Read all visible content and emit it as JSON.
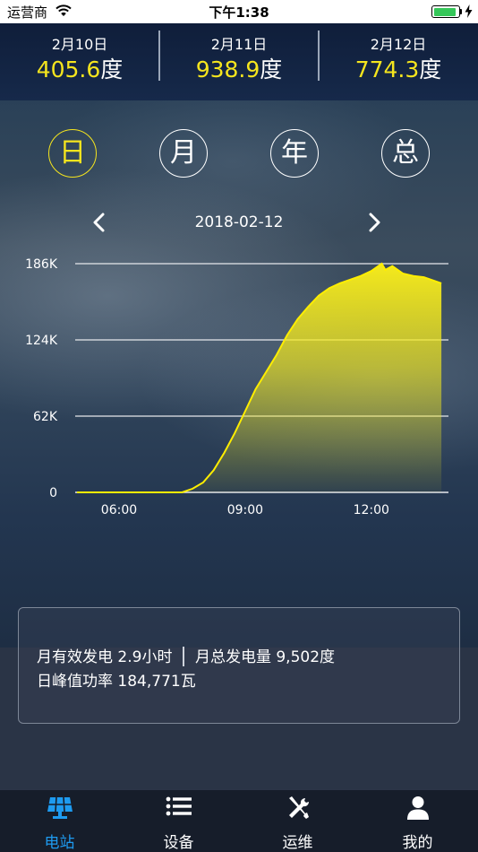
{
  "status_bar": {
    "carrier": "运营商",
    "time": "下午1:38",
    "battery_level": 0.9,
    "icons": [
      "wifi-icon",
      "battery-icon",
      "charging-bolt-icon"
    ]
  },
  "daily_summary": [
    {
      "date": "2月10日",
      "value": "405.6",
      "unit": "度"
    },
    {
      "date": "2月11日",
      "value": "938.9",
      "unit": "度"
    },
    {
      "date": "2月12日",
      "value": "774.3",
      "unit": "度"
    }
  ],
  "period_tabs": [
    {
      "label": "日",
      "active": true
    },
    {
      "label": "月",
      "active": false
    },
    {
      "label": "年",
      "active": false
    },
    {
      "label": "总",
      "active": false
    }
  ],
  "date_nav": {
    "date": "2018-02-12",
    "prev_icon": "chevron-left-icon",
    "next_icon": "chevron-right-icon"
  },
  "chart_data": {
    "type": "area",
    "title": "",
    "xlabel": "",
    "ylabel": "",
    "x_ticks": [
      "06:00",
      "09:00",
      "12:00"
    ],
    "y_ticks": [
      "0",
      "62K",
      "124K",
      "186K"
    ],
    "xlim": [
      "05:00",
      "13:45"
    ],
    "ylim": [
      0,
      186000
    ],
    "grid": true,
    "legend": "none",
    "series": [
      {
        "x": [
          "05:00",
          "06:00",
          "06:30",
          "07:00",
          "07:30",
          "07:45",
          "08:00",
          "08:15",
          "08:30",
          "08:45",
          "09:00",
          "09:15",
          "09:30",
          "09:45",
          "10:00",
          "10:15",
          "10:30",
          "10:45",
          "11:00",
          "11:15",
          "11:30",
          "11:45",
          "12:00",
          "12:10",
          "12:15",
          "12:20",
          "12:30",
          "12:45",
          "13:00",
          "13:15",
          "13:30",
          "13:40"
        ],
        "y": [
          0,
          0,
          0,
          0,
          0,
          3000,
          8000,
          18000,
          32000,
          48000,
          66000,
          84000,
          98000,
          112000,
          128000,
          141000,
          151000,
          160000,
          166000,
          170000,
          173000,
          176000,
          180000,
          184000,
          186000,
          181000,
          184000,
          178000,
          176000,
          175000,
          172000,
          170000
        ]
      }
    ],
    "colors": {
      "fill_top": "#f5ea1c",
      "stroke": "#ffee00",
      "grid": "#e6e8ec"
    }
  },
  "summary": {
    "monthly_hours_label": "月有效发电",
    "monthly_hours_value": "2.9小时",
    "monthly_total_label": "月总发电量",
    "monthly_total_value": "9,502度",
    "peak_power_label": "日峰值功率",
    "peak_power_value": "184,771瓦"
  },
  "tabbar": [
    {
      "label": "电站",
      "icon": "solar-panel-icon",
      "active": true
    },
    {
      "label": "设备",
      "icon": "list-icon",
      "active": false
    },
    {
      "label": "运维",
      "icon": "tools-icon",
      "active": false
    },
    {
      "label": "我的",
      "icon": "user-icon",
      "active": false
    }
  ],
  "colors": {
    "accent_yellow": "#f5e51e",
    "accent_blue": "#1e9bf0"
  }
}
